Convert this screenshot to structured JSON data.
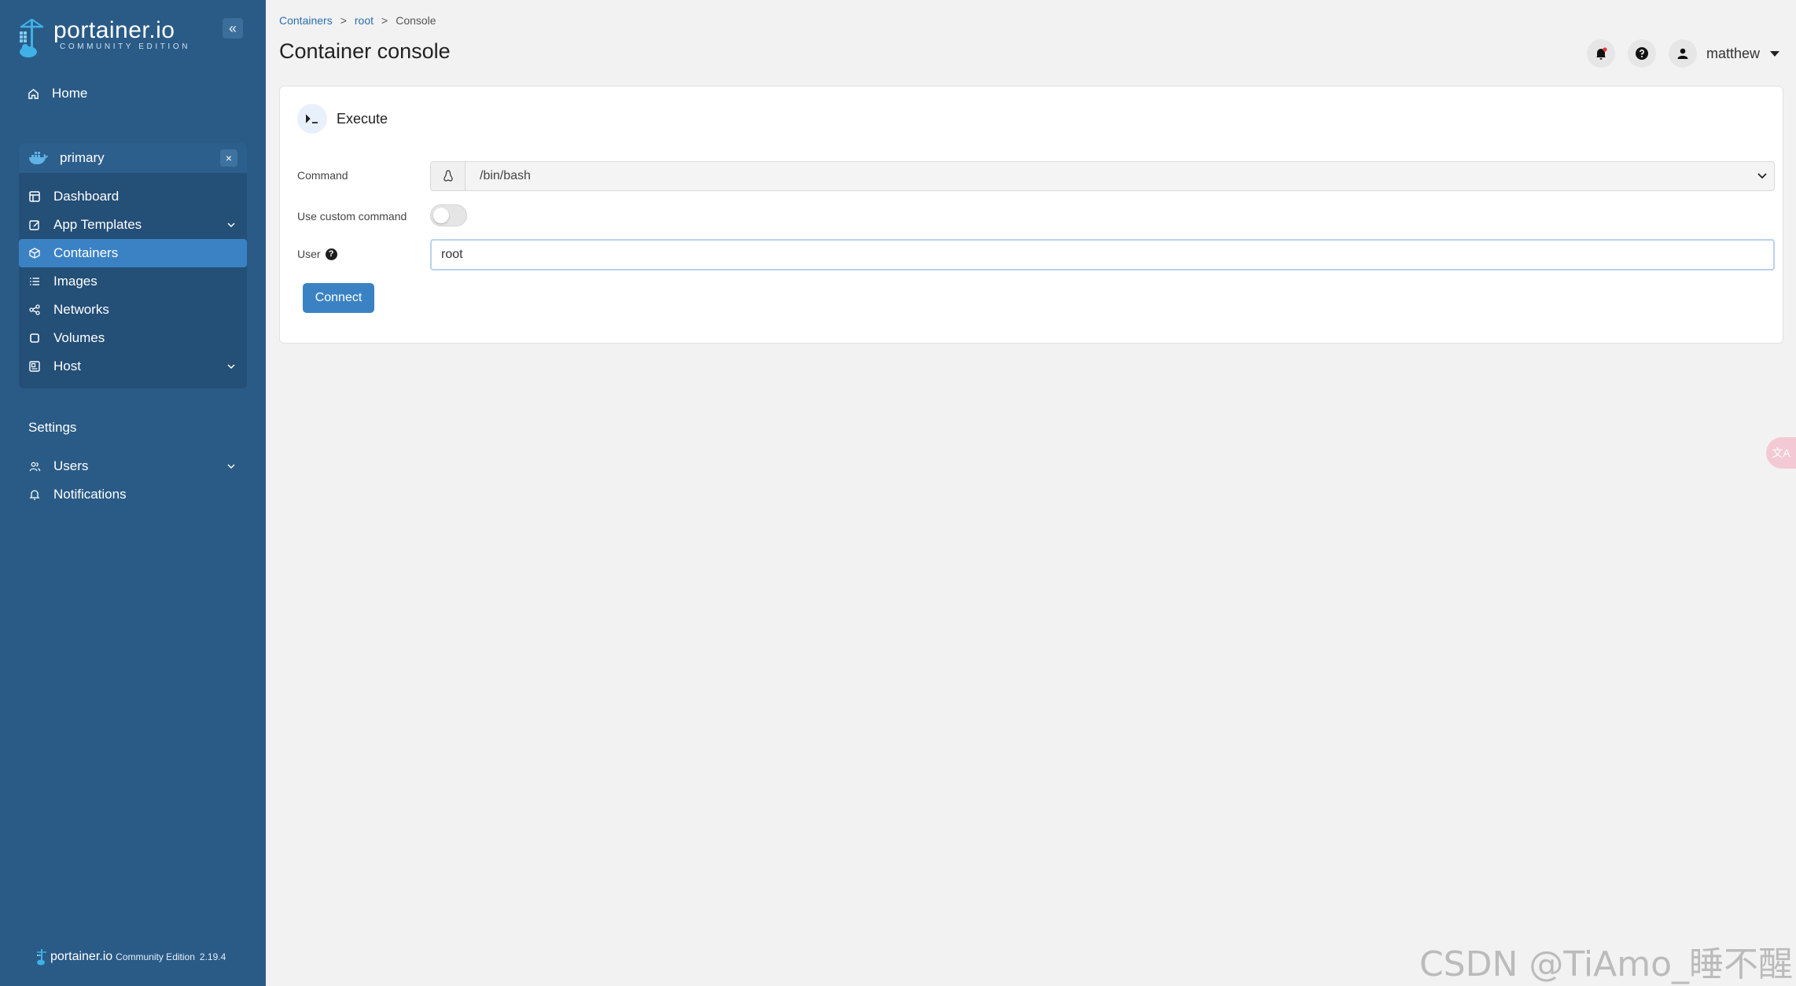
{
  "brand": {
    "name": "portainer.io",
    "edition": "COMMUNITY EDITION"
  },
  "sidebar": {
    "collapse_glyph": "«",
    "home_label": "Home",
    "environment": {
      "name": "primary",
      "close_glyph": "×",
      "items": [
        {
          "label": "Dashboard",
          "icon": "dashboard-icon",
          "has_chevron": false
        },
        {
          "label": "App Templates",
          "icon": "edit-icon",
          "has_chevron": true
        },
        {
          "label": "Containers",
          "icon": "box-icon",
          "has_chevron": false,
          "active": true
        },
        {
          "label": "Images",
          "icon": "list-icon",
          "has_chevron": false
        },
        {
          "label": "Networks",
          "icon": "share-icon",
          "has_chevron": false
        },
        {
          "label": "Volumes",
          "icon": "square-icon",
          "has_chevron": false
        },
        {
          "label": "Host",
          "icon": "server-icon",
          "has_chevron": true
        }
      ]
    },
    "settings_title": "Settings",
    "settings_items": [
      {
        "label": "Users",
        "icon": "users-icon",
        "has_chevron": true
      },
      {
        "label": "Notifications",
        "icon": "bell-icon",
        "has_chevron": false
      }
    ],
    "footer": {
      "name": "portainer.io",
      "edition": "Community Edition",
      "version": "2.19.4"
    }
  },
  "breadcrumb": {
    "containers": "Containers",
    "sep1": ">",
    "root": "root",
    "sep2": ">",
    "current": "Console"
  },
  "page_title": "Container console",
  "user": {
    "name": "matthew"
  },
  "card": {
    "title": "Execute",
    "command_label": "Command",
    "command_value": "/bin/bash",
    "custom_label": "Use custom command",
    "custom_enabled": false,
    "user_label": "User",
    "user_value": "root",
    "connect_label": "Connect"
  },
  "translate_glyph": "文A",
  "watermark": "CSDN @TiAmo_睡不醒",
  "colors": {
    "sidebar_bg": "#2a5b87",
    "env_panel": "#244f77",
    "active_item": "#3b82c4",
    "primary_button": "#3b82c4",
    "page_bg": "#f2f2f2"
  }
}
